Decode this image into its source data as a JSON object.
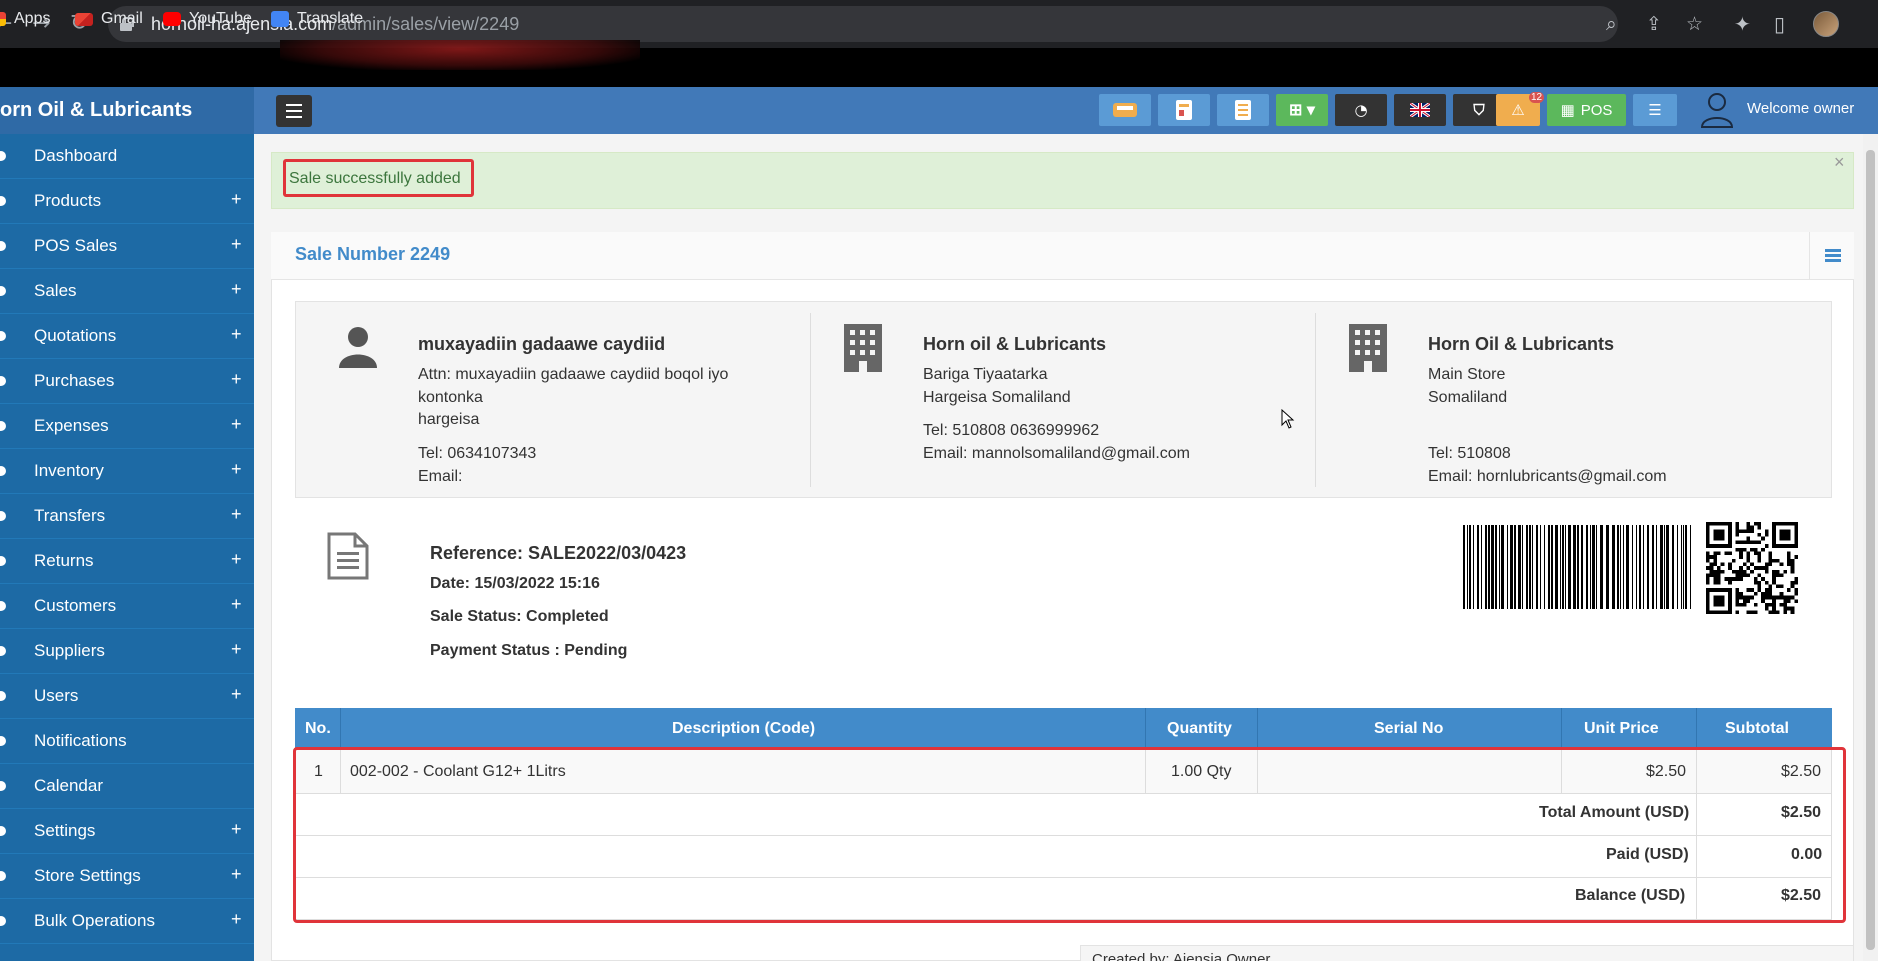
{
  "browser": {
    "url_host": "hornoil-ha.ajensia.com",
    "url_path": "/admin/sales/view/2249",
    "bookmarks": [
      "Apps",
      "Gmail",
      "YouTube",
      "Translate"
    ]
  },
  "header": {
    "brand": "orn Oil & Lubricants",
    "pos_label": "POS",
    "notification_count": "12",
    "welcome": "Welcome owner"
  },
  "sidebar": {
    "items": [
      {
        "label": "Dashboard",
        "expandable": false
      },
      {
        "label": "Products",
        "expandable": true
      },
      {
        "label": "POS Sales",
        "expandable": true
      },
      {
        "label": "Sales",
        "expandable": true
      },
      {
        "label": "Quotations",
        "expandable": true
      },
      {
        "label": "Purchases",
        "expandable": true
      },
      {
        "label": "Expenses",
        "expandable": true
      },
      {
        "label": "Inventory",
        "expandable": true
      },
      {
        "label": "Transfers",
        "expandable": true
      },
      {
        "label": "Returns",
        "expandable": true
      },
      {
        "label": "Customers",
        "expandable": true
      },
      {
        "label": "Suppliers",
        "expandable": true
      },
      {
        "label": "Users",
        "expandable": true
      },
      {
        "label": "Notifications",
        "expandable": false
      },
      {
        "label": "Calendar",
        "expandable": false
      },
      {
        "label": "Settings",
        "expandable": true
      },
      {
        "label": "Store Settings",
        "expandable": true
      },
      {
        "label": "Bulk Operations",
        "expandable": true
      }
    ],
    "plus": "+"
  },
  "alert": {
    "message": "Sale successfully added",
    "close": "×"
  },
  "sale": {
    "title": "Sale Number 2249",
    "customer": {
      "name": "muxayadiin gadaawe caydiid",
      "attn": "Attn: muxayadiin gadaawe caydiid boqol iyo",
      "attn2": "kontonka",
      "city": "hargeisa",
      "tel": "Tel: 0634107343",
      "email": "Email:"
    },
    "biller": {
      "name": "Horn oil & Lubricants",
      "address": "Bariga Tiyaatarka",
      "city": "Hargeisa Somaliland",
      "tel": "Tel: 510808 0636999962",
      "email": "Email: mannolsomaliland@gmail.com"
    },
    "warehouse": {
      "name": "Horn Oil & Lubricants",
      "address": "Main Store",
      "city": "Somaliland",
      "tel": "Tel: 510808",
      "email": "Email: hornlubricants@gmail.com"
    },
    "reference": "Reference: SALE2022/03/0423",
    "date": "Date: 15/03/2022 15:16",
    "sale_status": "Sale Status: Completed",
    "payment_status": "Payment Status : Pending"
  },
  "table": {
    "headers": [
      "No.",
      "Description (Code)",
      "Quantity",
      "Serial No",
      "Unit Price",
      "Subtotal"
    ],
    "rows": [
      {
        "no": "1",
        "description": "002-002 - Coolant G12+ 1Litrs",
        "quantity": "1.00 Qty",
        "serial": "",
        "unit_price": "$2.50",
        "subtotal": "$2.50"
      }
    ],
    "totals": [
      {
        "label": "Total Amount (USD)",
        "value": "$2.50"
      },
      {
        "label": "Paid (USD)",
        "value": "0.00"
      },
      {
        "label": "Balance (USD)",
        "value": "$2.50"
      }
    ]
  },
  "footer": {
    "created_by": "Created by: Ajensia Owner"
  },
  "colors": {
    "primary": "#428bca",
    "sidebar": "#1d6aa5",
    "alert_bg": "#dff0d8",
    "highlight": "#e0343a"
  }
}
